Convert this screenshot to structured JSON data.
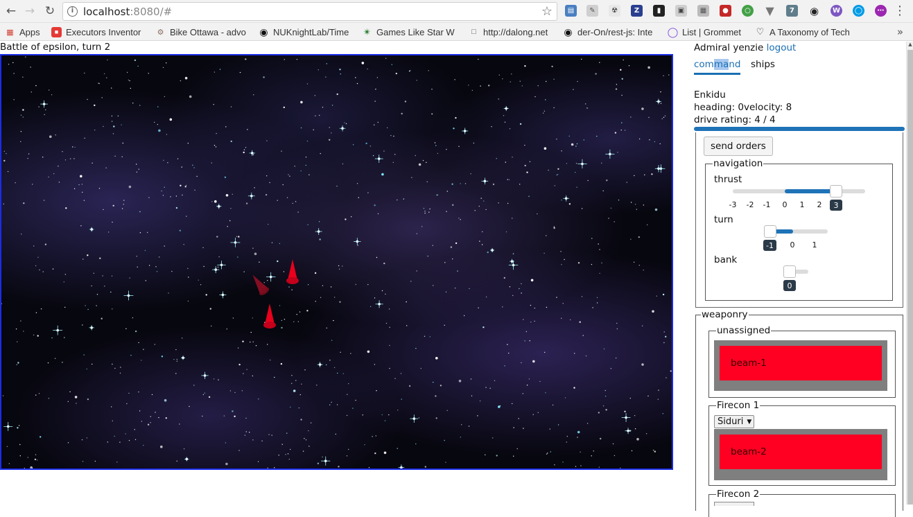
{
  "browser": {
    "url_host": "localhost",
    "url_rest": ":8080/#",
    "bookmarks": [
      {
        "label": "Apps"
      },
      {
        "label": "Executors Inventor"
      },
      {
        "label": "Bike Ottawa - advo"
      },
      {
        "label": "NUKnightLab/Time"
      },
      {
        "label": "Games Like Star W"
      },
      {
        "label": "http://dalong.net"
      },
      {
        "label": "der-On/rest-js: Inte"
      },
      {
        "label": "List | Grommet"
      },
      {
        "label": "A Taxonomy of Tech"
      }
    ],
    "extension_badge": "7",
    "extension_letter_z": "Z"
  },
  "page": {
    "battle_title": "Battle of epsilon, turn 2"
  },
  "colors": {
    "accent": "#1f73b7",
    "link": "#1a6fb3",
    "beam": "#ff0023",
    "tray": "#7f7f7f",
    "canvas_border": "#1b2ce8",
    "ship_red": "#e8001c"
  },
  "panel": {
    "admiral_prefix": "Admiral yenzie",
    "logout_label": "logout",
    "tabs": {
      "command_a": "com",
      "command_b": "ma",
      "command_c": "nd",
      "ships": "ships"
    },
    "ship": {
      "name": "Enkidu",
      "heading_line": "heading: 0velocity: 8",
      "drive_line": "drive rating: 4 / 4",
      "drive_fraction": 1.0
    },
    "send_orders_label": "send orders",
    "navigation": {
      "legend": "navigation",
      "thrust": {
        "label": "thrust",
        "ticks": [
          "-3",
          "-2",
          "-1",
          "0",
          "1",
          "2",
          "3"
        ],
        "value": 3
      },
      "turn": {
        "label": "turn",
        "ticks": [
          "-1",
          "0",
          "1"
        ],
        "value": -1
      },
      "bank": {
        "label": "bank",
        "ticks": [
          "0"
        ],
        "value": 0
      }
    },
    "weaponry": {
      "legend": "weaponry",
      "unassigned": {
        "legend": "unassigned",
        "beams": [
          "beam-1"
        ]
      },
      "firecon1": {
        "legend": "Firecon 1",
        "target": "Siduri",
        "beams": [
          "beam-2"
        ]
      },
      "firecon2": {
        "legend": "Firecon 2"
      }
    }
  }
}
